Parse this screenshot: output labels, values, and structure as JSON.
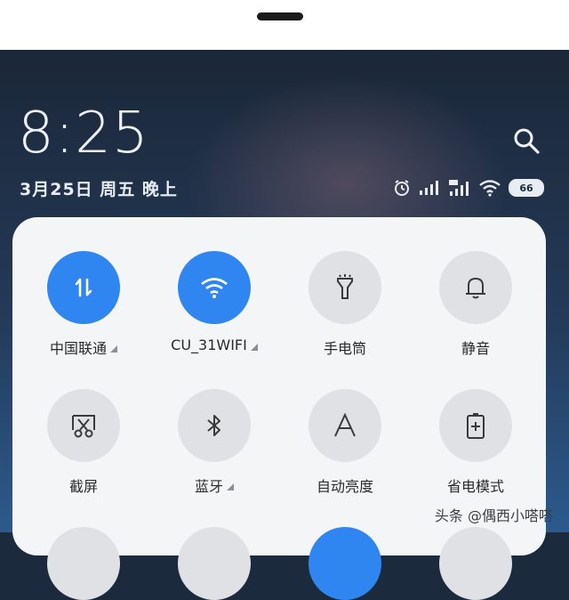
{
  "lock": {
    "time": "8:25",
    "date": "3月25日 周五 晚上",
    "battery": "66"
  },
  "tiles": [
    {
      "label": "中国联通",
      "icon": "data-arrows-icon",
      "active": true,
      "has_menu": true
    },
    {
      "label": "CU_31WIFI",
      "icon": "wifi-icon",
      "active": true,
      "has_menu": true
    },
    {
      "label": "手电筒",
      "icon": "flashlight-icon",
      "active": false,
      "has_menu": false
    },
    {
      "label": "静音",
      "icon": "bell-icon",
      "active": false,
      "has_menu": false
    },
    {
      "label": "截屏",
      "icon": "screenshot-scissors-icon",
      "active": false,
      "has_menu": false
    },
    {
      "label": "蓝牙",
      "icon": "bluetooth-icon",
      "active": false,
      "has_menu": true
    },
    {
      "label": "自动亮度",
      "icon": "auto-brightness-icon",
      "active": false,
      "has_menu": false
    },
    {
      "label": "省电模式",
      "icon": "battery-saver-icon",
      "active": false,
      "has_menu": false
    }
  ],
  "watermark": "头条 @偶西小嗒嗒",
  "colors": {
    "accent": "#2f86f0",
    "tile_off": "#dfe1e5",
    "panel": "#f4f5f7"
  }
}
